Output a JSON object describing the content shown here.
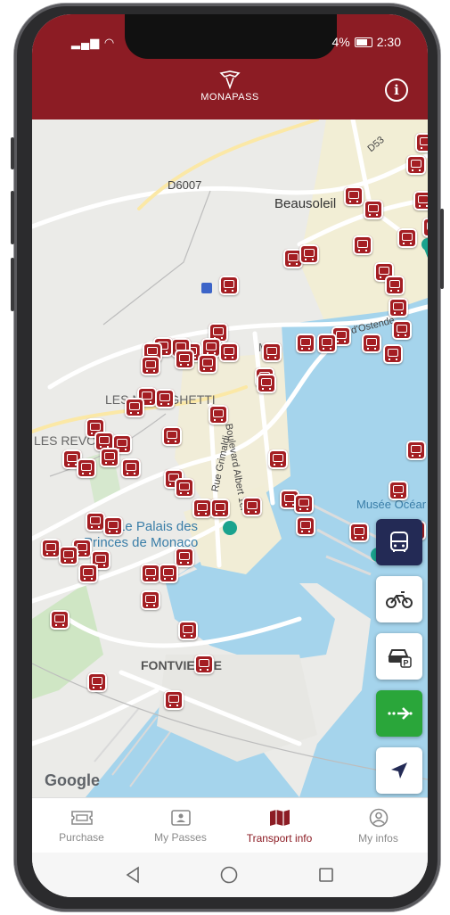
{
  "status_bar": {
    "left_icons": "📶 wifi",
    "battery_text": "4%",
    "time": "2:30"
  },
  "header": {
    "app_name": "MONAPASS",
    "info_icon": "info-icon"
  },
  "map": {
    "labels": {
      "d6007": "D6007",
      "beausoleil": "Beausoleil",
      "d53": "D53",
      "moneghetti": "LES MONEGHETTI",
      "revoires": "LES REVOIRES",
      "rue_grimaldi": "Rue Grimaldi",
      "blvd_albert": "Boulevard Albert 1er",
      "ostende": "Avenue d'Ostende",
      "palais_1": "Le Palais des",
      "palais_2": "Princes de Monaco",
      "musee": "Musée Océanographique",
      "fontvieille": "FONTVIEILLE",
      "mon": "Mon"
    },
    "google_logo": "Google",
    "colors": {
      "bus_marker": "#a41e23",
      "sea": "#a5d4ec",
      "header": "#8c1c24"
    }
  },
  "fab_buttons": [
    {
      "name": "bus-mode-button",
      "icon": "bus-icon",
      "active": true
    },
    {
      "name": "bike-mode-button",
      "icon": "bicycle-icon",
      "active": false
    },
    {
      "name": "parking-mode-button",
      "icon": "car-parking-icon",
      "active": false
    },
    {
      "name": "directions-button",
      "icon": "directions-icon",
      "active": false
    },
    {
      "name": "my-location-button",
      "icon": "location-arrow-icon",
      "active": false
    }
  ],
  "tabs": [
    {
      "label": "Purchase",
      "icon": "ticket-icon",
      "active": false
    },
    {
      "label": "My Passes",
      "icon": "id-card-icon",
      "active": false
    },
    {
      "label": "Transport info",
      "icon": "map-icon",
      "active": true
    },
    {
      "label": "My infos",
      "icon": "user-circle-icon",
      "active": false
    }
  ]
}
